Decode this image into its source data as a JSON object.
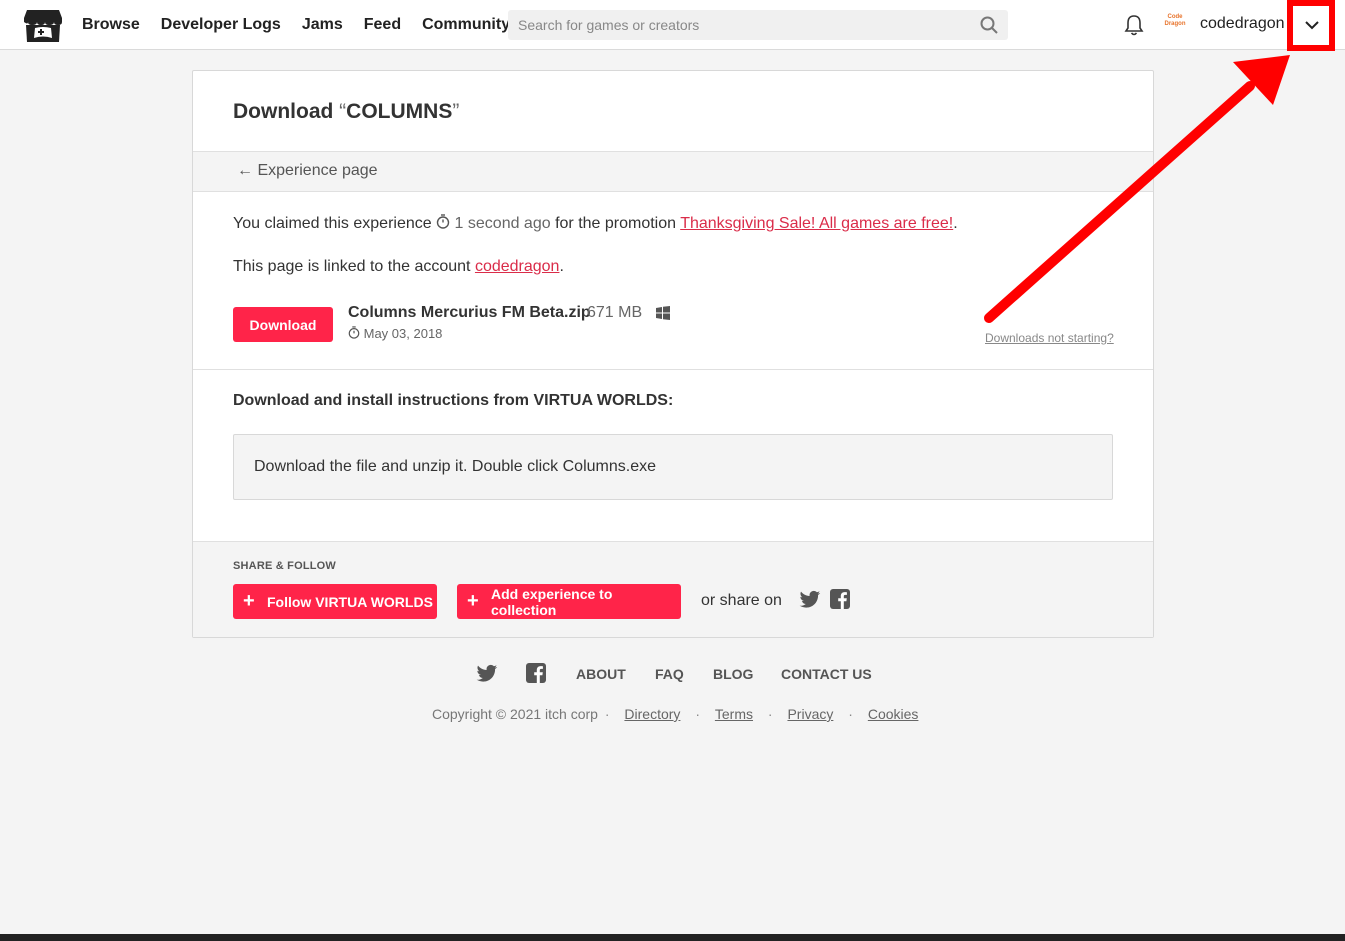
{
  "header": {
    "nav": [
      "Browse",
      "Developer Logs",
      "Jams",
      "Feed",
      "Community"
    ],
    "search_placeholder": "Search for games or creators",
    "avatar_text": "Code Dragon",
    "username": "codedragon"
  },
  "page": {
    "title_prefix": "Download ",
    "title_open_quote": "“",
    "title_name": "COLUMNS",
    "title_close_quote": "”",
    "back_link": "← Experience page",
    "claimed_prefix": "You claimed this experience",
    "claimed_time": "1 second ago",
    "claimed_mid": "for the promotion",
    "promotion_link": "Thanksgiving Sale! All games are free!",
    "claimed_suffix": ".",
    "linked_prefix": "This page is linked to the account",
    "linked_account": "codedragon",
    "linked_suffix": ".",
    "download_button": "Download",
    "file_name": "Columns Mercurius FM Beta.zip",
    "file_size": "671 MB",
    "file_date": "May 03, 2018",
    "not_starting": "Downloads not starting?",
    "instructions_heading": "Download and install instructions from VIRTUA WORLDS:",
    "instructions_text": "Download the file and unzip it. Double click Columns.exe"
  },
  "share": {
    "label": "SHARE & FOLLOW",
    "follow_button": "Follow VIRTUA WORLDS",
    "collection_button": "Add experience to collection",
    "or_share": "or share on"
  },
  "footer": {
    "links": [
      "ABOUT",
      "FAQ",
      "BLOG",
      "CONTACT US"
    ],
    "copyright": "Copyright © 2021 itch corp",
    "legal": [
      "Directory",
      "Terms",
      "Privacy",
      "Cookies"
    ]
  },
  "colors": {
    "accent": "#ff2449",
    "link": "#da2c49",
    "annotation": "#ff0000"
  },
  "icons": [
    "itchio-logo-icon",
    "search-icon",
    "bell-icon",
    "chevron-down-icon",
    "clock-icon",
    "windows-icon",
    "twitter-icon",
    "facebook-icon"
  ]
}
